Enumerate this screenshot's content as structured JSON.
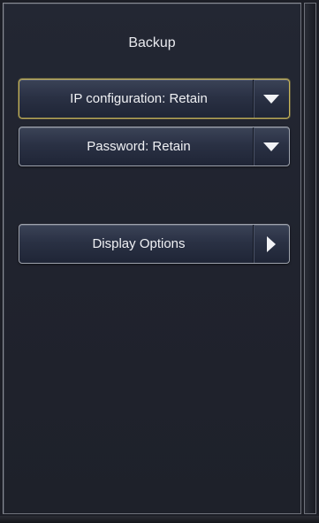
{
  "panel": {
    "title": "Backup"
  },
  "options": {
    "ip_configuration": {
      "label": "IP configuration: Retain",
      "icon": "dropdown-arrow-icon"
    },
    "password": {
      "label": "Password: Retain",
      "icon": "dropdown-arrow-icon"
    },
    "display_options": {
      "label": "Display Options",
      "icon": "chevron-right-icon"
    }
  },
  "colors": {
    "background": "#1c1e26",
    "button_border": "#9ea3ad",
    "focus_border": "#c9b65a",
    "text": "#f0f1f4"
  }
}
